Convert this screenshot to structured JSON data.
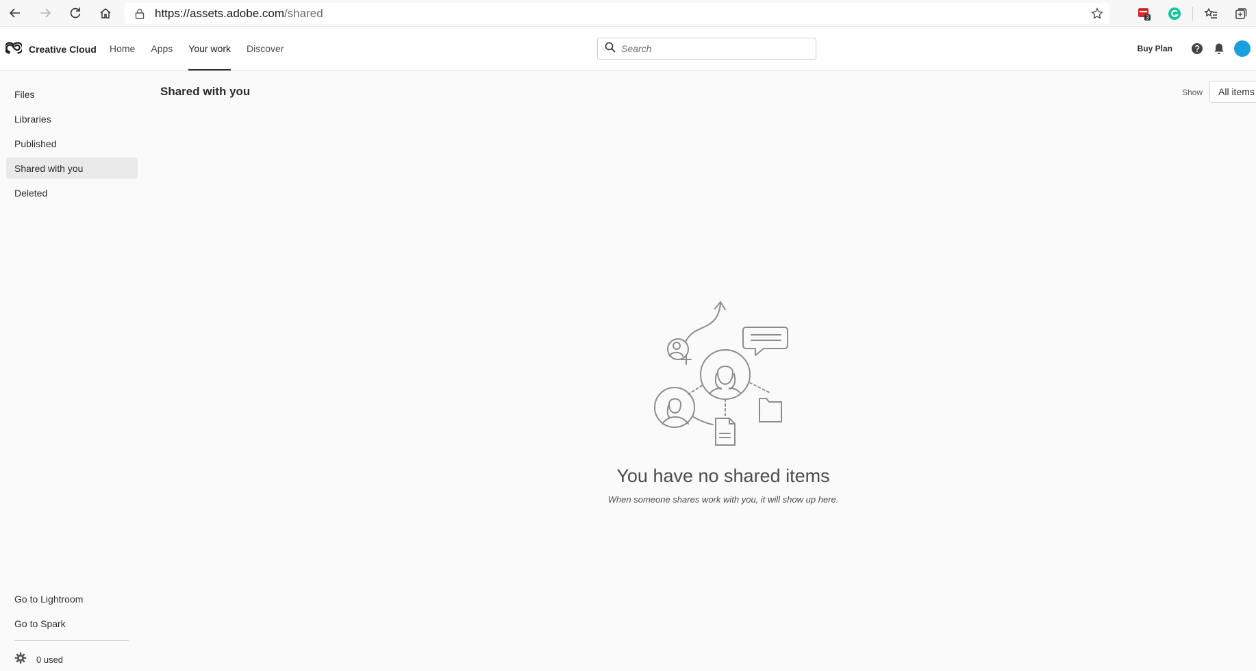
{
  "browser": {
    "url_host": "https://assets.adobe.com",
    "url_path": "/shared",
    "extension_badge": "3"
  },
  "app": {
    "brand_name": "Creative Cloud",
    "nav": [
      {
        "label": "Home"
      },
      {
        "label": "Apps"
      },
      {
        "label": "Your work",
        "active": true
      },
      {
        "label": "Discover"
      }
    ],
    "search_placeholder": "Search",
    "buy_plan_label": "Buy Plan",
    "avatar_color": "#1a9fe0"
  },
  "sidebar": {
    "items": [
      {
        "label": "Files"
      },
      {
        "label": "Libraries"
      },
      {
        "label": "Published"
      },
      {
        "label": "Shared with you",
        "selected": true
      },
      {
        "label": "Deleted"
      }
    ],
    "footer_links": [
      {
        "label": "Go to Lightroom"
      },
      {
        "label": "Go to Spark"
      }
    ],
    "storage_label": "0 used"
  },
  "main": {
    "title": "Shared with you",
    "show_label": "Show",
    "filter_value": "All items",
    "empty_title": "You have no shared items",
    "empty_subtitle": "When someone shares work with you, it will show up here."
  }
}
